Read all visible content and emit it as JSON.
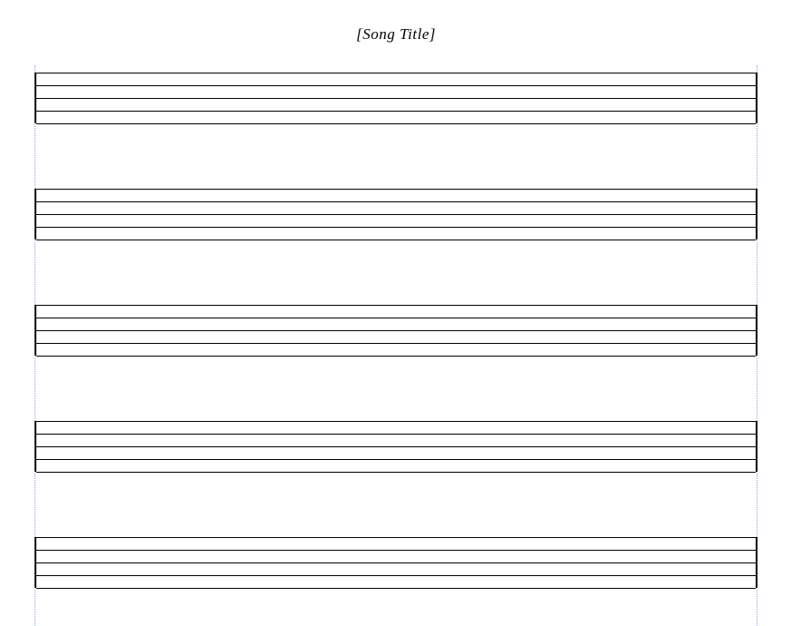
{
  "title": "[Song Title]",
  "staff_count": 5,
  "lines_per_staff": 5
}
